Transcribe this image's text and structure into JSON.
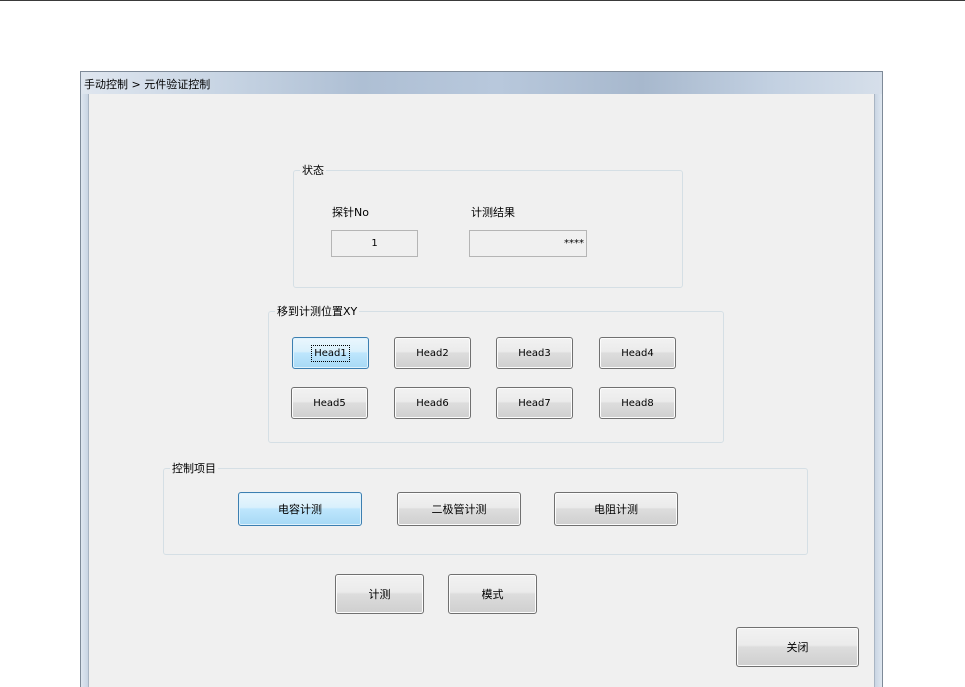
{
  "window": {
    "title": "手动控制 > 元件验证控制"
  },
  "status_group": {
    "label": "状态",
    "probe_no_label": "探针No",
    "probe_no_value": "1",
    "measure_result_label": "计测结果",
    "measure_result_value": "****"
  },
  "move_group": {
    "label": "移到计测位置XY",
    "heads": [
      "Head1",
      "Head2",
      "Head3",
      "Head4",
      "Head5",
      "Head6",
      "Head7",
      "Head8"
    ],
    "selected": "Head1"
  },
  "control_group": {
    "label": "控制项目",
    "items": [
      "电容计测",
      "二极管计测",
      "电阻计测"
    ],
    "selected": "电容计测"
  },
  "actions": {
    "measure_label": "计测",
    "mode_label": "模式",
    "close_label": "关闭"
  },
  "colors": {
    "selected_button": "#bee6fd",
    "window_background": "#f0f0f0"
  }
}
